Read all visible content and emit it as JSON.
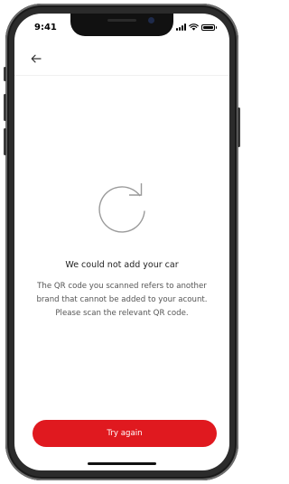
{
  "status_bar": {
    "time": "9:41",
    "icons": [
      "cellular-signal-icon",
      "wifi-icon",
      "battery-icon"
    ]
  },
  "nav": {
    "back_icon": "arrow-left-icon"
  },
  "main": {
    "icon": "refresh-icon",
    "title": "We could not add your car",
    "message": "The QR code you scanned refers to another brand that cannot be added to your acount. Please scan the relevant QR code."
  },
  "actions": {
    "try_again_label": "Try again"
  },
  "colors": {
    "accent": "#e0191f",
    "icon_stroke": "#9a9a9a",
    "text_primary": "#222222",
    "text_secondary": "#555555"
  }
}
